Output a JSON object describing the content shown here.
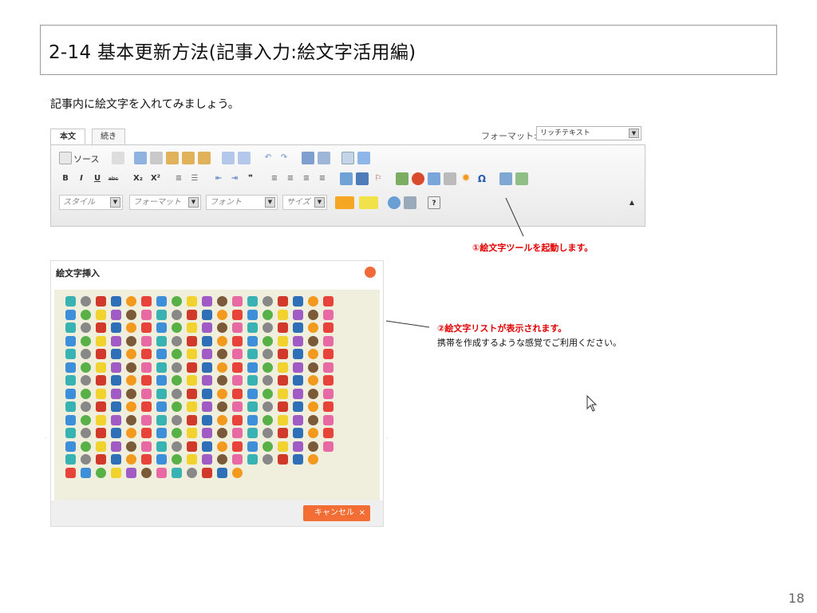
{
  "slide": {
    "title": "2-14 基本更新方法(記事入力:絵文字活用編)",
    "intro": "記事内に絵文字を入れてみましょう。",
    "page_number": "18"
  },
  "editor": {
    "tabs": [
      "本文",
      "続き"
    ],
    "format_label": "フォーマット:",
    "format_value": "リッチテキスト",
    "source_label": "ソース",
    "style_label": "スタイル",
    "format_combo": "フォーマット",
    "font_combo": "フォント",
    "size_combo": "サイズ",
    "bold": "B",
    "italic": "I",
    "underline": "U",
    "strike": "abc",
    "subscript": "X₂",
    "superscript": "X²"
  },
  "callouts": {
    "step1": "①絵文字ツールを起動します。",
    "step2": "②絵文字リストが表示されます。",
    "step2_note": "携帯を作成するような感覚でご利用ください。"
  },
  "dialog": {
    "title": "絵文字挿入",
    "cancel_label": "キャンセル",
    "cancel_x": "×"
  },
  "colors": {
    "accent": "#f26e34",
    "callout": "#e00000"
  },
  "icons": [
    "source-icon",
    "cut-icon",
    "copy-icon",
    "paste-icon",
    "spellcheck-icon",
    "undo-icon",
    "redo-icon",
    "find-icon",
    "bold-icon",
    "list-icon",
    "align-icon",
    "link-icon",
    "image-icon",
    "table-icon",
    "emoji-icon",
    "omega-icon",
    "emoji-grid-icons"
  ]
}
